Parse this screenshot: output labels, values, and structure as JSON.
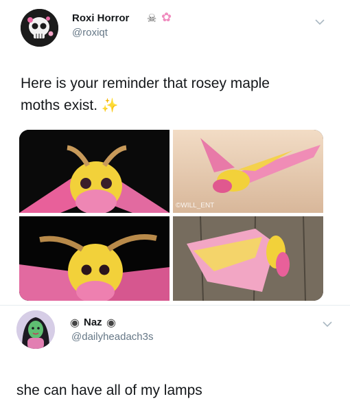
{
  "tweet": {
    "author_name": "Roxi Horror",
    "author_handle": "@roxiqt",
    "avatar_icon": "skull-avatar-icon",
    "name_emoji": "skull-icon flower-icon",
    "text_line1": "Here is your reminder that rosey maple",
    "text_line2": "moths exist.",
    "sparkle_icon": "sparkles-icon",
    "photos": [
      {
        "subject": "rosy maple moth",
        "watermark": ""
      },
      {
        "subject": "rosy maple moth",
        "watermark": "©WILL_ENT"
      },
      {
        "subject": "rosy maple moth",
        "watermark": ""
      },
      {
        "subject": "rosy maple moth",
        "watermark": ""
      }
    ]
  },
  "reply": {
    "author_name": "Naz",
    "author_handle": "@dailyheadach3s",
    "avatar_icon": "green-girl-avatar-icon",
    "name_emoji": "eye-icon",
    "text": "she can have all of my lamps"
  },
  "colors": {
    "text": "#14171a",
    "muted": "#657786",
    "divider": "#e6ecf0",
    "moth_pink": "#e8609a",
    "moth_yellow": "#f2d13a"
  }
}
